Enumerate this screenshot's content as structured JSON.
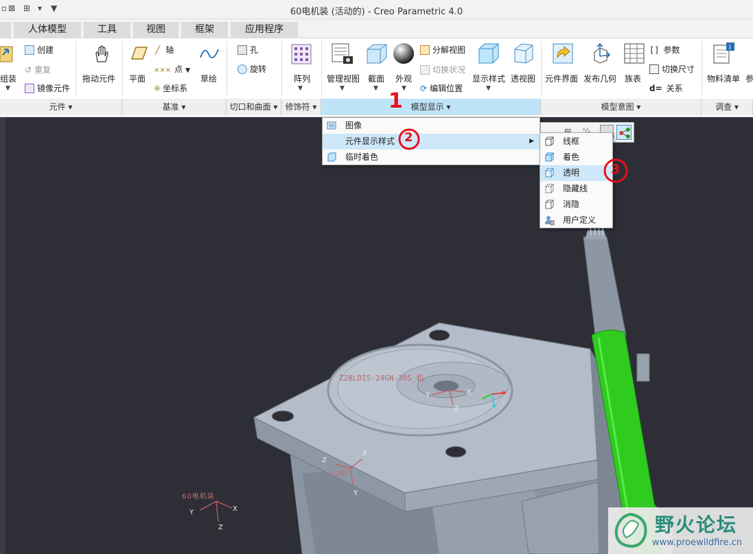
{
  "window": {
    "title": "60电机装 (活动的) - Creo Parametric 4.0"
  },
  "tabs": [
    "人体模型",
    "工具",
    "视图",
    "框架",
    "应用程序"
  ],
  "groups": {
    "yuanjian": "元件 ▾",
    "jizhun": "基准 ▾",
    "qiekou": "切口和曲面 ▾",
    "xiushifu": "修饰符 ▾",
    "moxingxianshi": "模型显示 ▾",
    "moxingyitu": "模型意图 ▾",
    "diaocha": "调查 ▾"
  },
  "tools": {
    "zuzhuang": "组装",
    "chuangjian": "创建",
    "chongfu": "重复",
    "jingxiang": "镜像元件",
    "tuodong": "拖动元件",
    "pingmian": "平面",
    "zhou": "轴",
    "dian": "点",
    "zuobiaoxi": "坐标系",
    "caohui": "草绘",
    "kong": "孔",
    "xuanzhuan": "旋转",
    "zhenlie": "阵列",
    "guanli_shitu": "管理视图",
    "jiemian": "截面",
    "waiguan": "外观",
    "fenjie_shitu": "分解视图",
    "qiehuan_zhuangkuang": "切换状况",
    "bianji_weizhi": "编辑位置",
    "xianshi_yangshi": "显示样式",
    "toushitu": "透视图",
    "yuanjian_jiemian": "元件界面",
    "fabu_jihe": "发布几何",
    "zubiao": "族表",
    "canshu": "参数",
    "qiehuan_chicun": "切换尺寸",
    "guanxi": "关系",
    "wuliao_qingdan": "物料清单",
    "can": "参"
  },
  "menu_main": {
    "items": [
      "图像",
      "元件显示样式",
      "临时着色"
    ],
    "highlighted": 1
  },
  "menu_sub": {
    "items": [
      "线框",
      "着色",
      "透明",
      "隐藏线",
      "消隐",
      "用户定义"
    ],
    "highlighted": 2
  },
  "annotations": [
    "1",
    "2",
    "3"
  ],
  "viewport": {
    "part_label": "Z2BLDI5-24GN-30S_机",
    "axis_m3": "M3螺",
    "axis_60": "60电机装",
    "axis_x": "X",
    "axis_y": "Y",
    "axis_z": "Z"
  },
  "watermark": {
    "title": "野火论坛",
    "url": "www.proewildfire.cn"
  },
  "colors": {
    "viewport_bg": "#2d2e36",
    "ribbon_active": "#bfe3f7",
    "cable_green": "#2fcc1f",
    "annotation_red": "#e8101a"
  }
}
